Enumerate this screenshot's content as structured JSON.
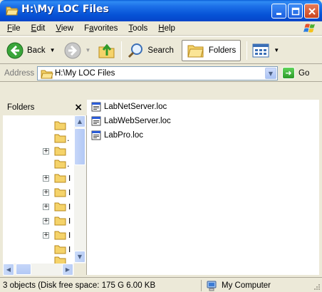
{
  "window": {
    "title": "H:\\My LOC Files",
    "icon": "folder-open-icon"
  },
  "menu": {
    "items": [
      "File",
      "Edit",
      "View",
      "Favorites",
      "Tools",
      "Help"
    ],
    "mnemonics": [
      "F",
      "E",
      "V",
      "a",
      "T",
      "H"
    ]
  },
  "toolbar": {
    "back_label": "Back",
    "search_label": "Search",
    "folders_label": "Folders"
  },
  "address": {
    "label": "Address",
    "value": "H:\\My LOC Files",
    "go_label": "Go"
  },
  "folders_pane": {
    "title": "Folders",
    "close_glyph": "×",
    "tree_items": [
      {
        "label": ".",
        "expander": false
      },
      {
        "label": ".",
        "expander": false
      },
      {
        "label": ".",
        "expander": true
      },
      {
        "label": "",
        "expander": false
      },
      {
        "label": "I",
        "expander": true
      },
      {
        "label": "I",
        "expander": true
      },
      {
        "label": "I",
        "expander": true
      },
      {
        "label": "I",
        "expander": true
      },
      {
        "label": "I",
        "expander": true
      },
      {
        "label": "I",
        "expander": false
      }
    ]
  },
  "files": [
    {
      "name": "LabNetServer.loc",
      "icon": "loc-file-icon"
    },
    {
      "name": "LabWebServer.loc",
      "icon": "loc-file-icon"
    },
    {
      "name": "LabPro.loc",
      "icon": "loc-file-icon"
    }
  ],
  "status": {
    "summary": "3 objects (Disk free space: 175 G 6.00 KB",
    "location": "My Computer"
  },
  "colors": {
    "title_bar": "#0652d6",
    "window_bg": "#ece9d8",
    "close_button": "#c9451f",
    "go_button": "#2c9a29"
  }
}
